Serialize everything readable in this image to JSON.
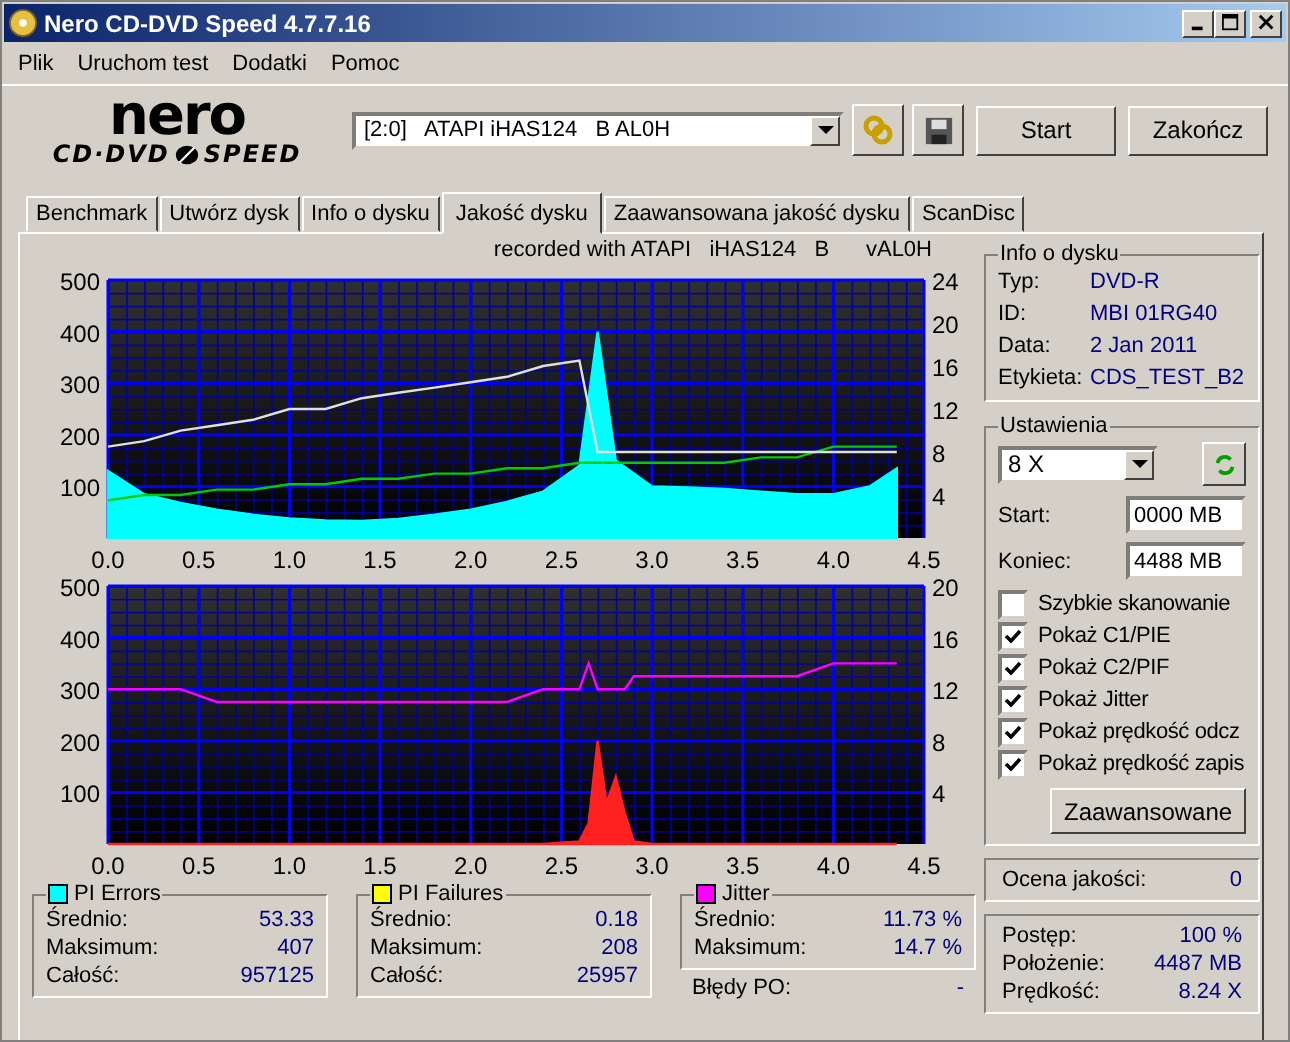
{
  "window": {
    "title": "Nero CD-DVD Speed 4.7.7.16"
  },
  "menu": [
    "Plik",
    "Uruchom test",
    "Dodatki",
    "Pomoc"
  ],
  "logo": {
    "top": "nero",
    "left": "CD·DVD",
    "right": "SPEED"
  },
  "toolbar": {
    "drive": "[2:0]   ATAPI iHAS124   B AL0H",
    "start": "Start",
    "exit": "Zakończ"
  },
  "tabs": [
    {
      "label": "Benchmark",
      "selected": false
    },
    {
      "label": "Utwórz dysk",
      "selected": false
    },
    {
      "label": "Info o dysku",
      "selected": false
    },
    {
      "label": "Jakość dysku",
      "selected": true
    },
    {
      "label": "Zaawansowana jakość dysku",
      "selected": false
    },
    {
      "label": "ScanDisc",
      "selected": false
    }
  ],
  "recorded_with": "recorded with ATAPI   iHAS124   B      vAL0H",
  "charts": [
    {
      "chart_data": {
        "type": "line",
        "x": [
          0,
          0.2,
          0.4,
          0.6,
          0.8,
          1.0,
          1.2,
          1.4,
          1.6,
          1.8,
          2.0,
          2.2,
          2.4,
          2.6,
          2.7,
          2.8,
          3.0,
          3.2,
          3.4,
          3.6,
          3.8,
          4.0,
          4.2,
          4.35
        ],
        "xlim": [
          0,
          4.5
        ],
        "ylim": [
          0,
          500
        ],
        "y2lim": [
          0,
          24
        ],
        "xticks": [
          {
            "value": 0,
            "label": "0.0"
          },
          {
            "value": 0.5,
            "label": "0.5"
          },
          {
            "value": 1,
            "label": "1.0"
          },
          {
            "value": 1.5,
            "label": "1.5"
          },
          {
            "value": 2,
            "label": "2.0"
          },
          {
            "value": 2.5,
            "label": "2.5"
          },
          {
            "value": 3,
            "label": "3.0"
          },
          {
            "value": 3.5,
            "label": "3.5"
          },
          {
            "value": 4,
            "label": "4.0"
          },
          {
            "value": 4.5,
            "label": "4.5"
          }
        ],
        "yticks": [
          100,
          200,
          300,
          400,
          500
        ],
        "y2ticks": [
          4,
          8,
          12,
          16,
          20,
          24
        ],
        "series": [
          {
            "type": "area",
            "color": "#00ffff",
            "values": [
              130,
              85,
              68,
              55,
              45,
              38,
              34,
              33,
              37,
              45,
              55,
              70,
              90,
              140,
              400,
              150,
              100,
              98,
              95,
              90,
              85,
              85,
              100,
              135
            ]
          },
          {
            "type": "line",
            "color": "#00cc00",
            "axis": "y2",
            "values": [
              3.5,
              4,
              4,
              4.5,
              4.5,
              5,
              5,
              5.5,
              5.5,
              6,
              6,
              6.5,
              6.5,
              7,
              7,
              7,
              7,
              7,
              7,
              7.5,
              7.5,
              8.5,
              8.5,
              8.5
            ]
          },
          {
            "type": "line",
            "color": "#e0e0e0",
            "axis": "y2",
            "values": [
              8.5,
              9,
              10,
              10.5,
              11,
              12,
              12,
              13,
              13.5,
              14,
              14.5,
              15,
              16,
              16.5,
              8,
              8,
              8,
              8,
              8,
              8,
              8,
              8,
              8,
              8
            ]
          }
        ],
        "grid": true
      }
    },
    {
      "chart_data": {
        "type": "line",
        "x": [
          0,
          0.2,
          0.4,
          0.6,
          0.8,
          1.0,
          1.2,
          1.4,
          1.6,
          1.8,
          2.0,
          2.2,
          2.4,
          2.6,
          2.65,
          2.7,
          2.75,
          2.8,
          2.85,
          2.9,
          3.0,
          3.2,
          3.4,
          3.6,
          3.8,
          4.0,
          4.2,
          4.35
        ],
        "xlim": [
          0,
          4.5
        ],
        "ylim": [
          0,
          500
        ],
        "y2lim": [
          0,
          20
        ],
        "xticks": [
          {
            "value": 0,
            "label": "0.0"
          },
          {
            "value": 0.5,
            "label": "0.5"
          },
          {
            "value": 1,
            "label": "1.0"
          },
          {
            "value": 1.5,
            "label": "1.5"
          },
          {
            "value": 2,
            "label": "2.0"
          },
          {
            "value": 2.5,
            "label": "2.5"
          },
          {
            "value": 3,
            "label": "3.0"
          },
          {
            "value": 3.5,
            "label": "3.5"
          },
          {
            "value": 4,
            "label": "4.0"
          },
          {
            "value": 4.5,
            "label": "4.5"
          }
        ],
        "yticks": [
          100,
          200,
          300,
          400,
          500
        ],
        "y2ticks": [
          4,
          8,
          12,
          16,
          20
        ],
        "series": [
          {
            "type": "area",
            "color": "#ff2020",
            "values": [
              0,
              0,
              0,
              0,
              0,
              0,
              0,
              0,
              0,
              0,
              0,
              0,
              0,
              5,
              40,
              200,
              80,
              130,
              60,
              5,
              0,
              0,
              0,
              0,
              0,
              0,
              0,
              0
            ]
          },
          {
            "type": "line",
            "color": "#ff00ff",
            "axis": "y2",
            "values": [
              12,
              12,
              12,
              11,
              11,
              11,
              11,
              11,
              11,
              11,
              11,
              11,
              12,
              12,
              14,
              12,
              12,
              12,
              12,
              13,
              13,
              13,
              13,
              13,
              13,
              14,
              14,
              14
            ]
          }
        ],
        "grid": true
      }
    }
  ],
  "disc_info": {
    "title": "Info o dysku",
    "rows": [
      {
        "label": "Typ:",
        "value": "DVD-R"
      },
      {
        "label": "ID:",
        "value": "MBI 01RG40"
      },
      {
        "label": "Data:",
        "value": "2 Jan 2011"
      },
      {
        "label": "Etykieta:",
        "value": "CDS_TEST_B2"
      }
    ]
  },
  "settings": {
    "title": "Ustawienia",
    "speed": "8 X",
    "start_label": "Start:",
    "start_value": "0000 MB",
    "end_label": "Koniec:",
    "end_value": "4488 MB",
    "options": [
      {
        "label": "Szybkie skanowanie",
        "checked": false
      },
      {
        "label": "Pokaż C1/PIE",
        "checked": true
      },
      {
        "label": "Pokaż C2/PIF",
        "checked": true
      },
      {
        "label": "Pokaż Jitter",
        "checked": true
      },
      {
        "label": "Pokaż prędkość odcz",
        "checked": true
      },
      {
        "label": "Pokaż prędkość zapis",
        "checked": true
      }
    ],
    "advanced": "Zaawansowane"
  },
  "quality": {
    "label": "Ocena jakości:",
    "value": "0"
  },
  "progress": [
    {
      "label": "Postęp:",
      "value": "100 %"
    },
    {
      "label": "Położenie:",
      "value": "4487 MB"
    },
    {
      "label": "Prędkość:",
      "value": "8.24 X"
    }
  ],
  "stats": [
    {
      "title": "PI Errors",
      "color": "#00ffff",
      "rows": [
        {
          "label": "Średnio:",
          "value": "53.33"
        },
        {
          "label": "Maksimum:",
          "value": "407"
        },
        {
          "label": "Całość:",
          "value": "957125"
        }
      ]
    },
    {
      "title": "PI Failures",
      "color": "#ffff00",
      "rows": [
        {
          "label": "Średnio:",
          "value": "0.18"
        },
        {
          "label": "Maksimum:",
          "value": "208"
        },
        {
          "label": "Całość:",
          "value": "25957"
        }
      ]
    },
    {
      "title": "Jitter",
      "color": "#ff00ff",
      "rows": [
        {
          "label": "Średnio:",
          "value": "11.73 %"
        },
        {
          "label": "Maksimum:",
          "value": "14.7 %"
        }
      ],
      "extra": {
        "label": "Błędy PO:",
        "value": "-"
      }
    }
  ]
}
